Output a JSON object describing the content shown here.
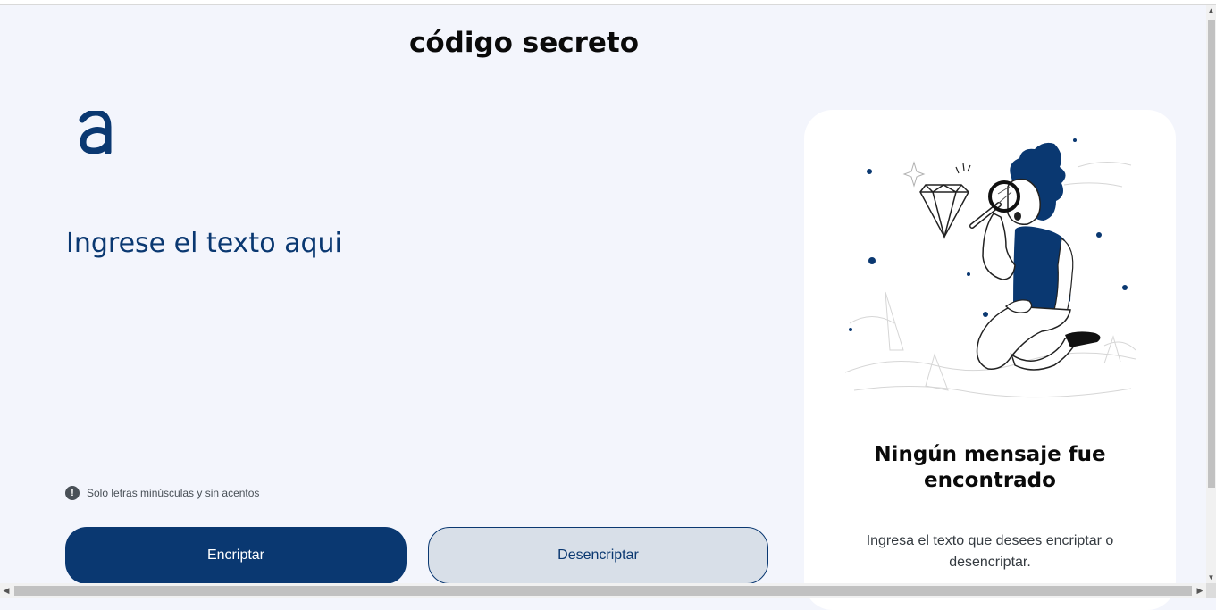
{
  "header": {
    "title": "código secreto"
  },
  "logo": {
    "icon": "alura-logo-icon",
    "color": "#0a3871"
  },
  "input": {
    "placeholder": "Ingrese el texto aqui",
    "value": ""
  },
  "hint": {
    "icon": "exclamation-icon",
    "text": "Solo letras minúsculas y sin acentos"
  },
  "buttons": {
    "encrypt": "Encriptar",
    "decrypt": "Desencriptar"
  },
  "output": {
    "illustration": "person-with-magnifier-illustration",
    "title": "Ningún mensaje fue encontrado",
    "text": "Ingresa el texto que desees encriptar o desencriptar."
  },
  "colors": {
    "primary": "#0a3871",
    "background": "#f3f5fc",
    "secondary_button": "#d8dfe8"
  }
}
